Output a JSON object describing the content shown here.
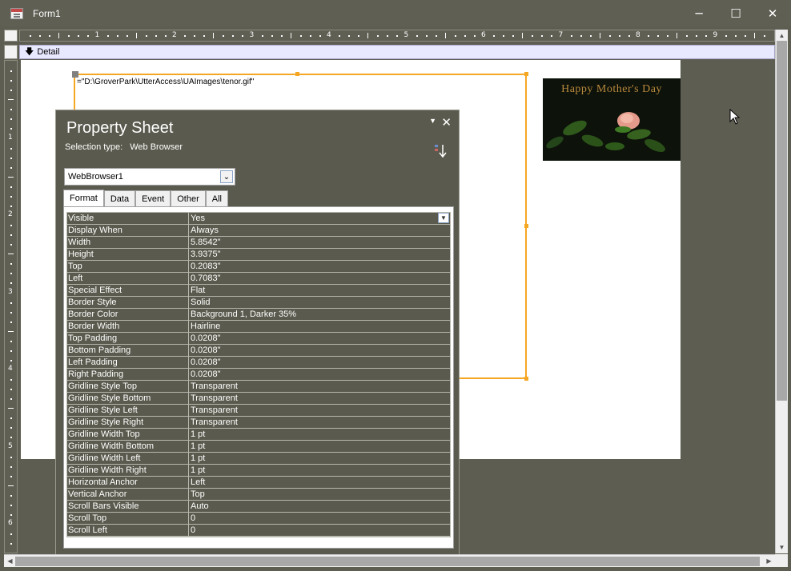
{
  "window": {
    "title": "Form1",
    "icon": "access-form-icon",
    "minimize_glyph": "─",
    "maximize_glyph": "☐",
    "close_glyph": "✕"
  },
  "ruler": {
    "numbers": [
      "1",
      "2",
      "3",
      "4",
      "5",
      "6",
      "7",
      "8",
      "9"
    ],
    "left_numbers": [
      "1",
      "2",
      "3",
      "4",
      "5",
      "6"
    ]
  },
  "section": {
    "arrow": "🡇",
    "label": "Detail"
  },
  "canvas": {
    "control_source": "=\"D:\\GroverPark\\UtterAccess\\UAImages\\tenor.gif\"",
    "image_text": "Happy Mother's Day"
  },
  "property_sheet": {
    "title": "Property Sheet",
    "selection_type_label": "Selection type:",
    "selection_type_value": "Web Browser",
    "object_name": "WebBrowser1",
    "tabs": [
      "Format",
      "Data",
      "Event",
      "Other",
      "All"
    ],
    "active_tab": "Format",
    "properties": [
      {
        "name": "Visible",
        "value": "Yes"
      },
      {
        "name": "Display When",
        "value": "Always"
      },
      {
        "name": "Width",
        "value": "5.8542\""
      },
      {
        "name": "Height",
        "value": "3.9375\""
      },
      {
        "name": "Top",
        "value": "0.2083\""
      },
      {
        "name": "Left",
        "value": "0.7083\""
      },
      {
        "name": "Special Effect",
        "value": "Flat"
      },
      {
        "name": "Border Style",
        "value": "Solid"
      },
      {
        "name": "Border Color",
        "value": "Background 1, Darker 35%"
      },
      {
        "name": "Border Width",
        "value": "Hairline"
      },
      {
        "name": "Top Padding",
        "value": "0.0208\""
      },
      {
        "name": "Bottom Padding",
        "value": "0.0208\""
      },
      {
        "name": "Left Padding",
        "value": "0.0208\""
      },
      {
        "name": "Right Padding",
        "value": "0.0208\""
      },
      {
        "name": "Gridline Style Top",
        "value": "Transparent"
      },
      {
        "name": "Gridline Style Bottom",
        "value": "Transparent"
      },
      {
        "name": "Gridline Style Left",
        "value": "Transparent"
      },
      {
        "name": "Gridline Style Right",
        "value": "Transparent"
      },
      {
        "name": "Gridline Width Top",
        "value": "1 pt"
      },
      {
        "name": "Gridline Width Bottom",
        "value": "1 pt"
      },
      {
        "name": "Gridline Width Left",
        "value": "1 pt"
      },
      {
        "name": "Gridline Width Right",
        "value": "1 pt"
      },
      {
        "name": "Horizontal Anchor",
        "value": "Left"
      },
      {
        "name": "Vertical Anchor",
        "value": "Top"
      },
      {
        "name": "Scroll Bars Visible",
        "value": "Auto"
      },
      {
        "name": "Scroll Top",
        "value": "0"
      },
      {
        "name": "Scroll Left",
        "value": "0"
      }
    ]
  },
  "colors": {
    "background": "#5d5d52",
    "selection_accent": "#f5a623",
    "canvas": "#ffffff",
    "section_bar": "#e8e8ff"
  }
}
